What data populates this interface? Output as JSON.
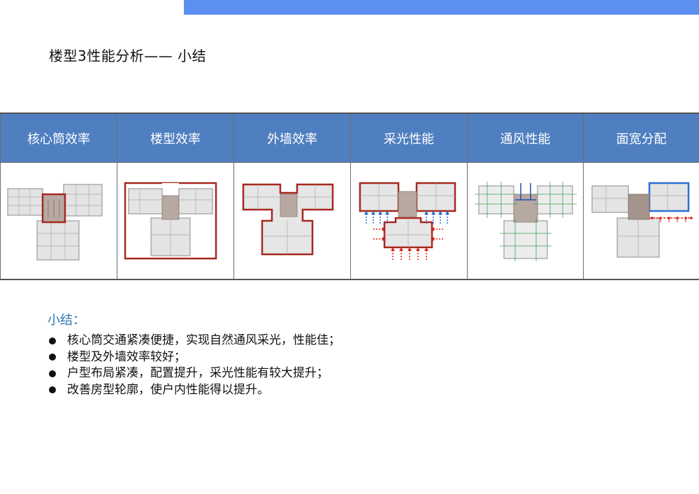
{
  "page_title": "楼型3性能分析—— 小结",
  "accent_bar_color": "#5b8ff0",
  "table": {
    "header_color": "#4f7fc0",
    "columns": [
      {
        "label": "核心筒效率",
        "diagram": "core-efficiency"
      },
      {
        "label": "楼型效率",
        "diagram": "building-form-efficiency"
      },
      {
        "label": "外墙效率",
        "diagram": "exterior-wall-efficiency"
      },
      {
        "label": "采光性能",
        "diagram": "daylighting-performance"
      },
      {
        "label": "通风性能",
        "diagram": "ventilation-performance"
      },
      {
        "label": "面宽分配",
        "diagram": "frontage-allocation"
      }
    ]
  },
  "summary": {
    "title": "小结：",
    "title_color": "#2e74b5",
    "items": [
      "核心筒交通紧凑便捷，实现自然通风采光，性能佳；",
      "楼型及外墙效率较好；",
      "户型布局紧凑，配置提升，采光性能有较大提升；",
      "改善房型轮廓，使户内性能得以提升。"
    ]
  }
}
